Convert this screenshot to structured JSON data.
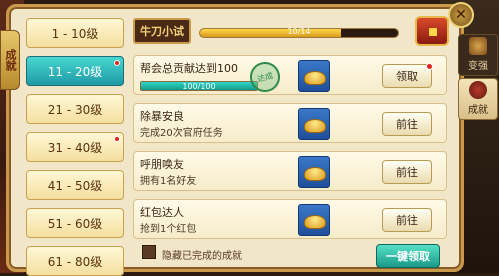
{
  "side_tab": {
    "label": "成就"
  },
  "header": {
    "title": "牛刀小试",
    "progress_text": "10/14",
    "progress_fraction": 0.71
  },
  "levels": [
    {
      "label": "1 - 10级",
      "active": false,
      "badge": false
    },
    {
      "label": "11 - 20级",
      "active": true,
      "badge": true
    },
    {
      "label": "21 - 30级",
      "active": false,
      "badge": false
    },
    {
      "label": "31 - 40级",
      "active": false,
      "badge": true
    },
    {
      "label": "41 - 50级",
      "active": false,
      "badge": false
    },
    {
      "label": "51 - 60级",
      "active": false,
      "badge": false
    },
    {
      "label": "61 - 80级",
      "active": false,
      "badge": false
    }
  ],
  "tasks": [
    {
      "title": "帮会总贡献达到100",
      "subtitle": "",
      "progress_text": "100/100",
      "progress_fraction": 1.0,
      "stamp": "达成",
      "button": "领取",
      "badge": true
    },
    {
      "title": "除暴安良",
      "subtitle": "完成20次官府任务",
      "progress_text": "",
      "button": "前往",
      "badge": false
    },
    {
      "title": "呼朋唤友",
      "subtitle": "拥有1名好友",
      "progress_text": "",
      "button": "前往",
      "badge": false
    },
    {
      "title": "红包达人",
      "subtitle": "抢到1个红包",
      "progress_text": "",
      "button": "前往",
      "badge": false
    }
  ],
  "footer": {
    "hide_completed_label": "隐藏已完成的成就",
    "claim_all_label": "一键领取"
  },
  "right_nav": [
    {
      "label": "变强"
    },
    {
      "label": "成就"
    }
  ],
  "icons": {
    "close": "close-icon",
    "chest": "treasure-chest-icon",
    "reward": "gold-ingot-icon"
  }
}
